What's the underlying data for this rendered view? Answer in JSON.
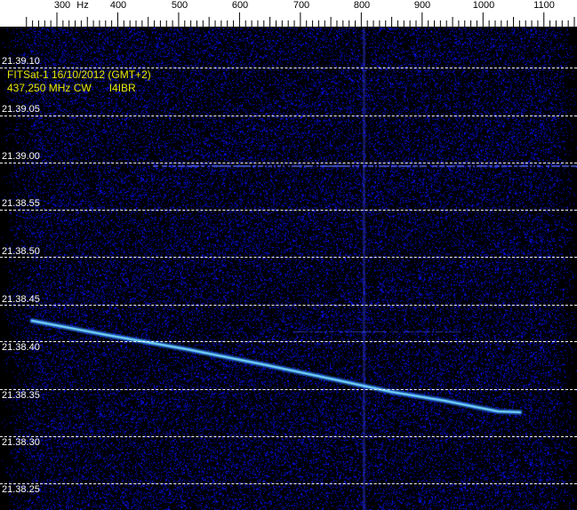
{
  "ruler": {
    "unit_label": "Hz",
    "ticks": [
      "300",
      "400",
      "500",
      "600",
      "700",
      "800",
      "900",
      "1000",
      "1100"
    ]
  },
  "caption": {
    "line1": "FITSat-1 16/10/2012 (GMT+2)",
    "line2": "437,250 MHz CW      I4IBR"
  },
  "time_labels": [
    "21.39.10",
    "21.39.05",
    "21.39.00",
    "21.38.55",
    "21.38.50",
    "21.38.45",
    "21.38.40",
    "21.38.35",
    "21.38.30",
    "21.38.25"
  ],
  "colors": {
    "background": "#000000",
    "noise": "#2a2aff",
    "signal": "#5fd0ff",
    "caption": "#e8e800",
    "ruler": "#ffffff"
  }
}
